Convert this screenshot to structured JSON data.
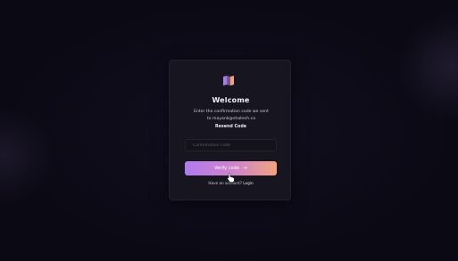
{
  "card": {
    "logo_icon": "logo-icon",
    "title": "Welcome",
    "subtitle_line1": "Enter the confirmation code we sent",
    "subtitle_line2": "to mayank@shatech.co",
    "resend_label": "Resend Code",
    "code_input": {
      "placeholder": "Confirmation code",
      "value": ""
    },
    "verify_button": {
      "label": "Verify code",
      "icon": "arrow-right-icon"
    },
    "footer": {
      "prompt": "Have an account?",
      "login_label": "Login"
    }
  },
  "colors": {
    "background": "#0b0913",
    "card": "#17151f",
    "gradient_start": "#b07af0",
    "gradient_end": "#f2a37c",
    "logo_purple": "#a77be8",
    "logo_peach": "#f0a17e"
  }
}
